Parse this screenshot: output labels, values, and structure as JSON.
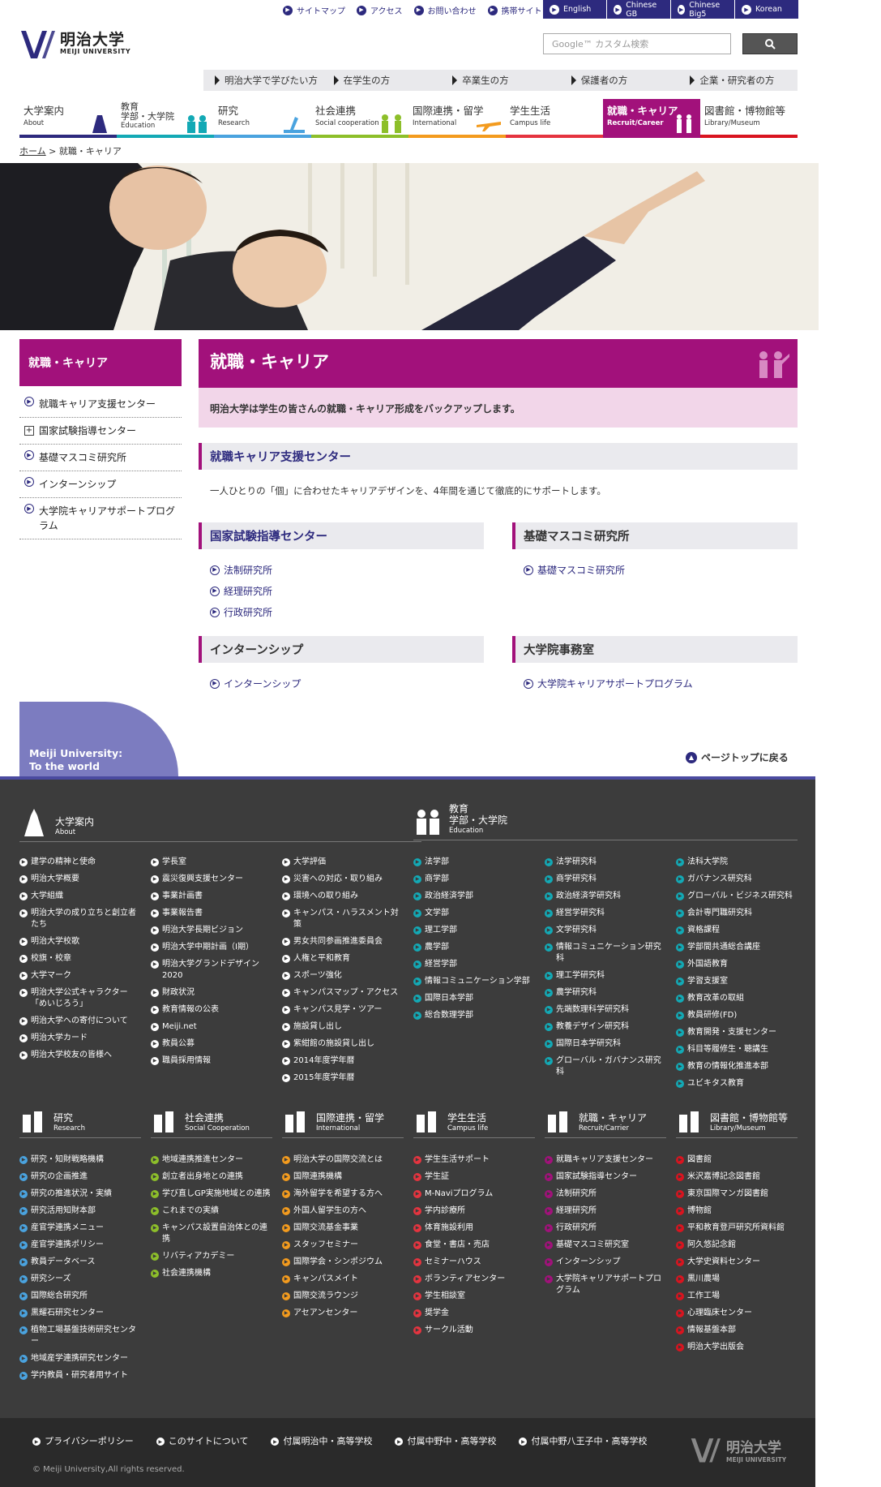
{
  "top_links": [
    "サイトマップ",
    "アクセス",
    "お問い合わせ",
    "携帯サイト"
  ],
  "languages": [
    "English",
    "Chinese GB",
    "Chinese Big5",
    "Korean"
  ],
  "logo": {
    "title": "明治大学",
    "subtitle": "MEIJI UNIVERSITY"
  },
  "search": {
    "placeholder": "Google™ カスタム検索"
  },
  "audience": [
    "明治大学で学びたい方",
    "在学生の方",
    "卒業生の方",
    "保護者の方",
    "企業・研究者の方"
  ],
  "gnav": [
    {
      "jp": "大学案内",
      "en": "About",
      "color": "#2d2a7e"
    },
    {
      "jp": "教育\n学部・大学院",
      "en": "Education",
      "color": "#13a9b5"
    },
    {
      "jp": "研究",
      "en": "Research",
      "color": "#4aa3df"
    },
    {
      "jp": "社会連携",
      "en": "Social cooperation",
      "color": "#8dbf2a"
    },
    {
      "jp": "国際連携・留学",
      "en": "International",
      "color": "#f39b1e"
    },
    {
      "jp": "学生生活",
      "en": "Campus life",
      "color": "#e5343f"
    },
    {
      "jp": "就職・キャリア",
      "en": "Recruit/Career",
      "color": "#a2117b"
    },
    {
      "jp": "図書館・博物館等",
      "en": "Library/Museum",
      "color": "#a2117b"
    }
  ],
  "breadcrumb": {
    "home": "ホーム",
    "sep": ">",
    "current": "就職・キャリア"
  },
  "sidebar": {
    "title": "就職・キャリア",
    "items": [
      "就職キャリア支援センター",
      "国家試験指導センター",
      "基礎マスコミ研究所",
      "インターンシップ",
      "大学院キャリアサポートプログラム"
    ]
  },
  "main": {
    "title": "就職・キャリア",
    "lead": "明治大学は学生の皆さんの就職・キャリア形成をバックアップします。",
    "sec1": {
      "title": "就職キャリア支援センター",
      "body": "一人ひとりの「個」に合わせたキャリアデザインを、4年間を通じて徹底的にサポートします。"
    },
    "sec2": {
      "title": "国家試験指導センター",
      "links": [
        "法制研究所",
        "経理研究所",
        "行政研究所"
      ]
    },
    "sec3": {
      "title": "基礎マスコミ研究所",
      "links": [
        "基礎マスコミ研究所"
      ]
    },
    "sec4": {
      "title": "インターンシップ",
      "links": [
        "インターンシップ"
      ]
    },
    "sec5": {
      "title": "大学院事務室",
      "links": [
        "大学院キャリアサポートプログラム"
      ]
    }
  },
  "to_world": "Meiji University:\nTo the world",
  "page_top": "ページトップに戻る",
  "footer": {
    "about": {
      "jp": "大学案内",
      "en": "About"
    },
    "about_c1": [
      "建学の精神と使命",
      "明治大学概要",
      "大学組織",
      "明治大学の成り立ちと創立者たち",
      "明治大学校歌",
      "校旗・校章",
      "大学マーク",
      "明治大学公式キャラクター「めいじろう」",
      "明治大学への寄付について",
      "明治大学カード",
      "明治大学校友の皆様へ"
    ],
    "about_c2": [
      "学長室",
      "震災復興支援センター",
      "事業計画書",
      "事業報告書",
      "明治大学長期ビジョン",
      "明治大学中期計画（Ⅰ期）",
      "明治大学グランドデザイン2020",
      "財政状況",
      "教育情報の公表",
      "Meiji.net",
      "教員公募",
      "職員採用情報"
    ],
    "about_c3": [
      "大学評価",
      "災害への対応・取り組み",
      "環境への取り組み",
      "キャンパス・ハラスメント対策",
      "男女共同参画推進委員会",
      "人権と平和教育",
      "スポーツ強化",
      "キャンパスマップ・アクセス",
      "キャンパス見学・ツアー",
      "施設貸し出し",
      "紫紺館の施設貸し出し",
      "2014年度学年暦",
      "2015年度学年暦"
    ],
    "edu": {
      "jp": "教育\n学部・大学院",
      "en": "Education"
    },
    "edu_c1": [
      "法学部",
      "商学部",
      "政治経済学部",
      "文学部",
      "理工学部",
      "農学部",
      "経営学部",
      "情報コミュニケーション学部",
      "国際日本学部",
      "総合数理学部"
    ],
    "edu_c2": [
      "法学研究科",
      "商学研究科",
      "政治経済学研究科",
      "経営学研究科",
      "文学研究科",
      "情報コミュニケーション研究科",
      "理工学研究科",
      "農学研究科",
      "先端数理科学研究科",
      "教養デザイン研究科",
      "国際日本学研究科",
      "グローバル・ガバナンス研究科"
    ],
    "edu_c3": [
      "法科大学院",
      "ガバナンス研究科",
      "グローバル・ビジネス研究科",
      "会計専門職研究科",
      "資格課程",
      "学部間共通総合講座",
      "外国語教育",
      "学習支援室",
      "教育改革の取組",
      "教員研修(FD)",
      "教育開発・支援センター",
      "科目等履修生・聴講生",
      "教育の情報化推進本部",
      "ユビキタス教育"
    ],
    "g2": [
      {
        "jp": "研究",
        "en": "Research",
        "color": "#4aa3df",
        "items": [
          "研究・知財戦略機構",
          "研究の企画推進",
          "研究の推進状況・実績",
          "研究活用知財本部",
          "産官学連携メニュー",
          "産官学連携ポリシー",
          "教員データベース",
          "研究シーズ",
          "国際総合研究所",
          "黒耀石研究センター",
          "植物工場基盤技術研究センター",
          "地域産学連携研究センター",
          "学内教員・研究者用サイト"
        ]
      },
      {
        "jp": "社会連携",
        "en": "Social Cooperation",
        "color": "#8dbf2a",
        "items": [
          "地域連携推進センター",
          "創立者出身地との連携",
          "学び直しGP実施地域との連携",
          "これまでの実績",
          "キャンパス設置自治体との連携",
          "リバティアカデミー",
          "社会連携機構"
        ]
      },
      {
        "jp": "国際連携・留学",
        "en": "International",
        "color": "#f39b1e",
        "items": [
          "明治大学の国際交流とは",
          "国際連携機構",
          "海外留学を希望する方へ",
          "外国人留学生の方へ",
          "国際交流基金事業",
          "スタッフセミナー",
          "国際学会・シンポジウム",
          "キャンパスメイト",
          "国際交流ラウンジ",
          "アセアンセンター"
        ]
      },
      {
        "jp": "学生生活",
        "en": "Campus life",
        "color": "#e5343f",
        "items": [
          "学生生活サポート",
          "学生証",
          "M-Naviプログラム",
          "学内診療所",
          "体育施設利用",
          "食堂・書店・売店",
          "セミナーハウス",
          "ボランティアセンター",
          "学生相談室",
          "奨学金",
          "サークル活動"
        ]
      },
      {
        "jp": "就職・キャリア",
        "en": "Recruit/Carrier",
        "color": "#a2117b",
        "items": [
          "就職キャリア支援センター",
          "国家試験指導センター",
          "法制研究所",
          "経理研究所",
          "行政研究所",
          "基礎マスコミ研究室",
          "インターンシップ",
          "大学院キャリアサポートプログラム"
        ]
      },
      {
        "jp": "図書館・博物館等",
        "en": "Library/Museum",
        "color": "#d9141f",
        "items": [
          "図書館",
          "米沢嘉博記念図書館",
          "東京国際マンガ図書館",
          "博物館",
          "平和教育登戸研究所資料館",
          "阿久悠記念館",
          "大学史資料センター",
          "黒川農場",
          "工作工場",
          "心理臨床センター",
          "情報基盤本部",
          "明治大学出版会"
        ]
      }
    ],
    "bottom_links": [
      "プライバシーポリシー",
      "このサイトについて",
      "付属明治中・高等学校",
      "付属中野中・高等学校",
      "付属中野八王子中・高等学校"
    ],
    "copyright": "© Meiji University,All rights reserved.",
    "logo_title": "明治大学",
    "logo_sub": "MEIJI UNIVERSITY"
  }
}
